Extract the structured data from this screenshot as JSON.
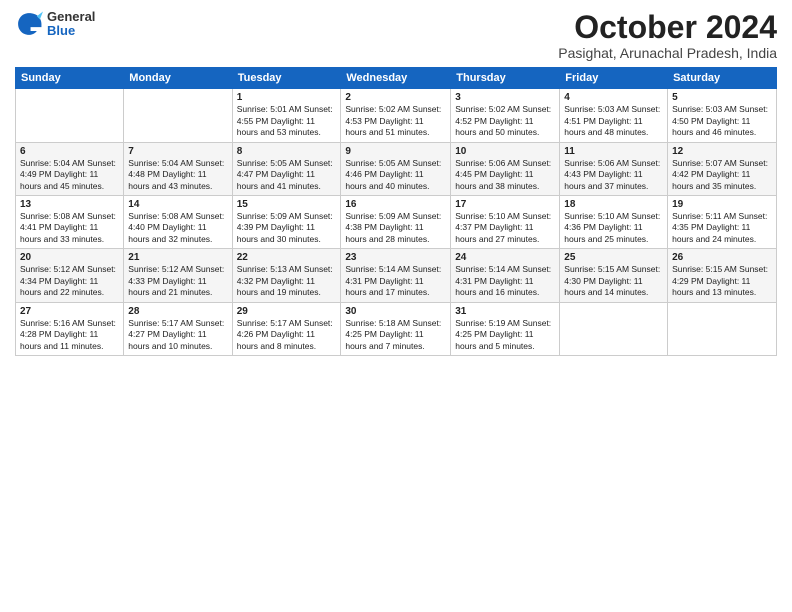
{
  "header": {
    "logo_general": "General",
    "logo_blue": "Blue",
    "title": "October 2024",
    "subtitle": "Pasighat, Arunachal Pradesh, India"
  },
  "days_of_week": [
    "Sunday",
    "Monday",
    "Tuesday",
    "Wednesday",
    "Thursday",
    "Friday",
    "Saturday"
  ],
  "weeks": [
    [
      {
        "day": "",
        "info": ""
      },
      {
        "day": "",
        "info": ""
      },
      {
        "day": "1",
        "info": "Sunrise: 5:01 AM\nSunset: 4:55 PM\nDaylight: 11 hours and 53 minutes."
      },
      {
        "day": "2",
        "info": "Sunrise: 5:02 AM\nSunset: 4:53 PM\nDaylight: 11 hours and 51 minutes."
      },
      {
        "day": "3",
        "info": "Sunrise: 5:02 AM\nSunset: 4:52 PM\nDaylight: 11 hours and 50 minutes."
      },
      {
        "day": "4",
        "info": "Sunrise: 5:03 AM\nSunset: 4:51 PM\nDaylight: 11 hours and 48 minutes."
      },
      {
        "day": "5",
        "info": "Sunrise: 5:03 AM\nSunset: 4:50 PM\nDaylight: 11 hours and 46 minutes."
      }
    ],
    [
      {
        "day": "6",
        "info": "Sunrise: 5:04 AM\nSunset: 4:49 PM\nDaylight: 11 hours and 45 minutes."
      },
      {
        "day": "7",
        "info": "Sunrise: 5:04 AM\nSunset: 4:48 PM\nDaylight: 11 hours and 43 minutes."
      },
      {
        "day": "8",
        "info": "Sunrise: 5:05 AM\nSunset: 4:47 PM\nDaylight: 11 hours and 41 minutes."
      },
      {
        "day": "9",
        "info": "Sunrise: 5:05 AM\nSunset: 4:46 PM\nDaylight: 11 hours and 40 minutes."
      },
      {
        "day": "10",
        "info": "Sunrise: 5:06 AM\nSunset: 4:45 PM\nDaylight: 11 hours and 38 minutes."
      },
      {
        "day": "11",
        "info": "Sunrise: 5:06 AM\nSunset: 4:43 PM\nDaylight: 11 hours and 37 minutes."
      },
      {
        "day": "12",
        "info": "Sunrise: 5:07 AM\nSunset: 4:42 PM\nDaylight: 11 hours and 35 minutes."
      }
    ],
    [
      {
        "day": "13",
        "info": "Sunrise: 5:08 AM\nSunset: 4:41 PM\nDaylight: 11 hours and 33 minutes."
      },
      {
        "day": "14",
        "info": "Sunrise: 5:08 AM\nSunset: 4:40 PM\nDaylight: 11 hours and 32 minutes."
      },
      {
        "day": "15",
        "info": "Sunrise: 5:09 AM\nSunset: 4:39 PM\nDaylight: 11 hours and 30 minutes."
      },
      {
        "day": "16",
        "info": "Sunrise: 5:09 AM\nSunset: 4:38 PM\nDaylight: 11 hours and 28 minutes."
      },
      {
        "day": "17",
        "info": "Sunrise: 5:10 AM\nSunset: 4:37 PM\nDaylight: 11 hours and 27 minutes."
      },
      {
        "day": "18",
        "info": "Sunrise: 5:10 AM\nSunset: 4:36 PM\nDaylight: 11 hours and 25 minutes."
      },
      {
        "day": "19",
        "info": "Sunrise: 5:11 AM\nSunset: 4:35 PM\nDaylight: 11 hours and 24 minutes."
      }
    ],
    [
      {
        "day": "20",
        "info": "Sunrise: 5:12 AM\nSunset: 4:34 PM\nDaylight: 11 hours and 22 minutes."
      },
      {
        "day": "21",
        "info": "Sunrise: 5:12 AM\nSunset: 4:33 PM\nDaylight: 11 hours and 21 minutes."
      },
      {
        "day": "22",
        "info": "Sunrise: 5:13 AM\nSunset: 4:32 PM\nDaylight: 11 hours and 19 minutes."
      },
      {
        "day": "23",
        "info": "Sunrise: 5:14 AM\nSunset: 4:31 PM\nDaylight: 11 hours and 17 minutes."
      },
      {
        "day": "24",
        "info": "Sunrise: 5:14 AM\nSunset: 4:31 PM\nDaylight: 11 hours and 16 minutes."
      },
      {
        "day": "25",
        "info": "Sunrise: 5:15 AM\nSunset: 4:30 PM\nDaylight: 11 hours and 14 minutes."
      },
      {
        "day": "26",
        "info": "Sunrise: 5:15 AM\nSunset: 4:29 PM\nDaylight: 11 hours and 13 minutes."
      }
    ],
    [
      {
        "day": "27",
        "info": "Sunrise: 5:16 AM\nSunset: 4:28 PM\nDaylight: 11 hours and 11 minutes."
      },
      {
        "day": "28",
        "info": "Sunrise: 5:17 AM\nSunset: 4:27 PM\nDaylight: 11 hours and 10 minutes."
      },
      {
        "day": "29",
        "info": "Sunrise: 5:17 AM\nSunset: 4:26 PM\nDaylight: 11 hours and 8 minutes."
      },
      {
        "day": "30",
        "info": "Sunrise: 5:18 AM\nSunset: 4:25 PM\nDaylight: 11 hours and 7 minutes."
      },
      {
        "day": "31",
        "info": "Sunrise: 5:19 AM\nSunset: 4:25 PM\nDaylight: 11 hours and 5 minutes."
      },
      {
        "day": "",
        "info": ""
      },
      {
        "day": "",
        "info": ""
      }
    ]
  ]
}
